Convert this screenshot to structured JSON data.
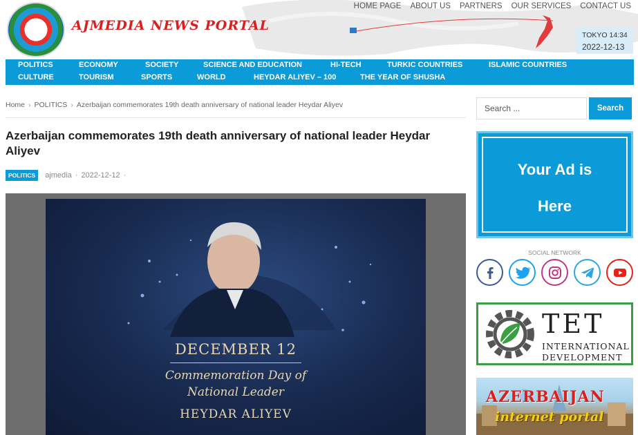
{
  "header": {
    "logo_text": "AJMEDIA NEWS PORTAL",
    "top_nav": [
      "HOME PAGE",
      "ABOUT US",
      "PARTNERS",
      "OUR SERVICES",
      "CONTACT US"
    ],
    "clock_city_time": "TOKYO 14:34",
    "clock_date": "2022-12-13"
  },
  "main_nav": {
    "row1": [
      "POLITICS",
      "ECONOMY",
      "SOCIETY",
      "SCIENCE AND EDUCATION",
      "HI-TECH",
      "TURKIC COUNTRIES",
      "ISLAMIC COUNTRIES"
    ],
    "row2": [
      "CULTURE",
      "TOURISM",
      "SPORTS",
      "WORLD",
      "HEYDAR ALIYEV – 100",
      "THE YEAR OF SHUSHA"
    ]
  },
  "breadcrumb": {
    "home": "Home",
    "category": "POLITICS",
    "current": "Azerbaijan commemorates 19th death anniversary of national leader Heydar Aliyev"
  },
  "article": {
    "title": "Azerbaijan commemorates 19th death anniversary of national leader Heydar Aliyev",
    "category_badge": "POLITICS",
    "author": "ajmedia",
    "date": "2022-12-12",
    "poster": {
      "line1": "DECEMBER 12",
      "line2": "Commemoration Day of",
      "line3": "National Leader",
      "line4": "HEYDAR ALIYEV"
    }
  },
  "sidebar": {
    "search_placeholder": "Search ...",
    "search_button": "Search",
    "ad_line1": "Your Ad is",
    "ad_line2": "Here",
    "social_title": "SOCIAL NETWORK",
    "social": [
      {
        "icon": "facebook-icon",
        "color": "#3b5998"
      },
      {
        "icon": "twitter-icon",
        "color": "#1da1f2"
      },
      {
        "icon": "instagram-icon",
        "color": "#c13584"
      },
      {
        "icon": "telegram-icon",
        "color": "#2ca5e0"
      },
      {
        "icon": "youtube-icon",
        "color": "#e62117"
      }
    ],
    "tet_word": "TET",
    "tet_line1": "INTERNATIONAL",
    "tet_line2": "DEVELOPMENT",
    "portal_line1": "AZERBAIJAN",
    "portal_line2": "internet portal"
  }
}
